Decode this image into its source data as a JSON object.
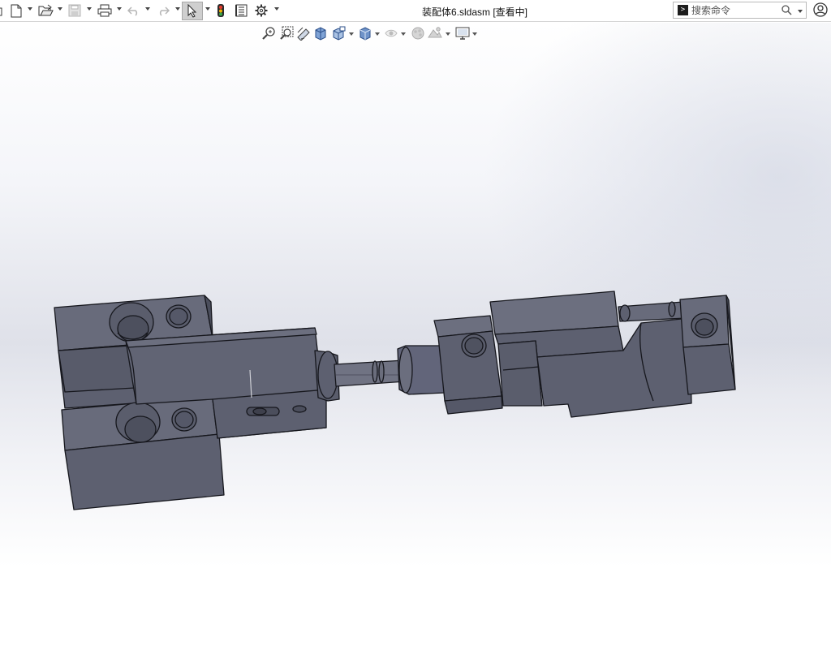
{
  "window": {
    "title": "装配体6.sldasm [查看中]"
  },
  "toolbar": {
    "items": [
      {
        "name": "new-document-icon",
        "has_dropdown": true
      },
      {
        "name": "open-folder-icon",
        "has_dropdown": true
      },
      {
        "name": "save-icon",
        "has_dropdown": true,
        "disabled": true
      },
      {
        "name": "print-icon",
        "has_dropdown": true
      },
      {
        "name": "undo-icon",
        "has_dropdown": true,
        "disabled": true
      },
      {
        "name": "redo-icon",
        "has_dropdown": true,
        "disabled": true
      },
      {
        "name": "select-cursor-icon",
        "has_dropdown": true,
        "active": true
      },
      {
        "name": "traffic-light-icon"
      },
      {
        "name": "file-properties-icon"
      },
      {
        "name": "options-gear-icon",
        "has_dropdown": true
      }
    ]
  },
  "search": {
    "placeholder": "搜索命令"
  },
  "view_toolbar": {
    "items": [
      "zoom-to-fit-icon",
      "zoom-to-area-icon",
      "previous-view-icon",
      "section-view-icon",
      "view-orientation-icon",
      "display-style-icon",
      "hide-show-items-icon",
      "edit-appearance-icon",
      "apply-scene-icon",
      "view-settings-icon"
    ]
  },
  "colors": {
    "part_face_front": "#5d6070",
    "part_face_top": "#686b7b",
    "part_face_side": "#4b4e5c",
    "edge": "#16171d",
    "viewport_mid": "#dfe1e9",
    "select_active": "#cfcfcf"
  }
}
